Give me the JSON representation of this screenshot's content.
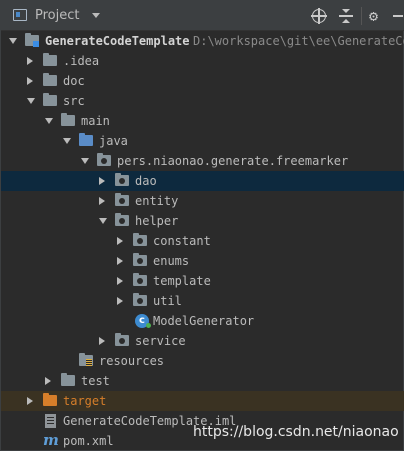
{
  "header": {
    "title": "Project",
    "icons": [
      "project-icon",
      "dropdown-icon",
      "locate-icon",
      "collapse-all-icon",
      "gear-icon",
      "minimize-icon"
    ]
  },
  "tree": {
    "root_label": "GenerateCodeTemplate",
    "root_path": "D:\\workspace\\git\\ee\\GenerateCodeT",
    "idea": ".idea",
    "doc": "doc",
    "src": "src",
    "main": "main",
    "java": "java",
    "package": "pers.niaonao.generate.freemarker",
    "dao": "dao",
    "entity": "entity",
    "helper": "helper",
    "constant": "constant",
    "enums": "enums",
    "template": "template",
    "util": "util",
    "model_generator": "ModelGenerator",
    "service": "service",
    "resources": "resources",
    "test": "test",
    "target": "target",
    "iml": "GenerateCodeTemplate.iml",
    "pom": "pom.xml"
  },
  "watermark": "https://blog.csdn.net/niaonao",
  "colors": {
    "background": "#2b2b2b",
    "header": "#3c3f41",
    "selection": "#0d293e",
    "folder_grey": "#87939a",
    "folder_blue": "#5a8cc7",
    "excluded_orange": "#d67e2a"
  }
}
